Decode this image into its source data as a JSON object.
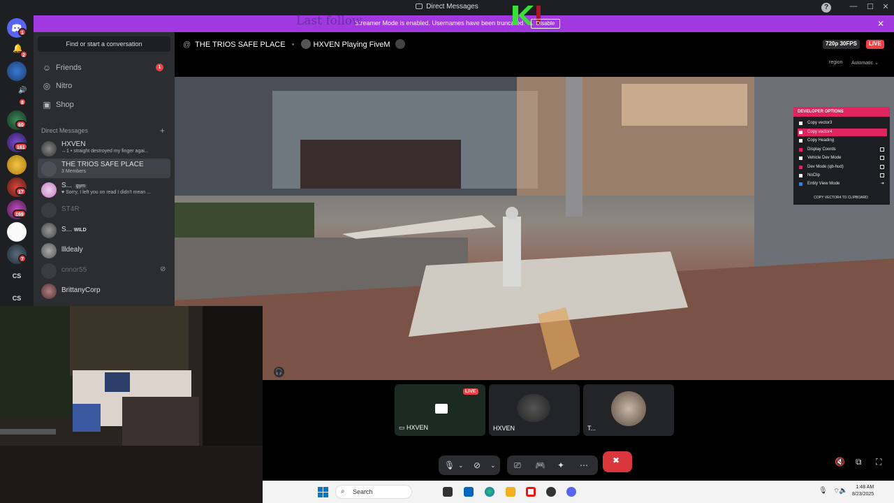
{
  "window": {
    "title": "Direct Messages",
    "help": "?",
    "minimize": "—",
    "maximize": "☐",
    "close": "✕"
  },
  "banner": {
    "message": "Streamer Mode is enabled. Usernames have been truncated.",
    "disable": "Disable",
    "close": "✕"
  },
  "overlay": {
    "last_follow": "Last follow"
  },
  "rail": {
    "badges": {
      "dm": "1",
      "server2": "2",
      "server3": "8",
      "server4": "60",
      "server5": "161",
      "server7": "17",
      "server8": "169",
      "server10": "7"
    },
    "cs1": "CS",
    "cs2": "CS"
  },
  "sidebar": {
    "find": "Find or start a conversation",
    "nav": [
      {
        "label": "Friends",
        "badge": "1"
      },
      {
        "label": "Nitro"
      },
      {
        "label": "Shop"
      }
    ],
    "dm_header": "Direct Messages",
    "dm_add": "+",
    "dms": [
      {
        "name": "HXVEN",
        "sub": "↔1 • straight destroyed my finger agai..."
      },
      {
        "name": "THE TRIOS SAFE PLACE",
        "sub": "3 Members"
      },
      {
        "name": "S...",
        "tag": "gym",
        "sub": "♥ Sorry, I left you on read I didn't mean ..."
      },
      {
        "name": "ST4R"
      },
      {
        "name": "S...",
        "tag": "WILD"
      },
      {
        "name": "llldealy"
      },
      {
        "name": "cnnor55"
      },
      {
        "name": "BrittanyCorp"
      }
    ]
  },
  "call": {
    "channel": "THE TRIOS SAFE PLACE",
    "activity": "HXVEN Playing FiveM",
    "quality": "720p 30FPS",
    "live": "LIVE",
    "region": "region",
    "region_value": "Automatic"
  },
  "dev_options": {
    "title": "DEVELOPER OPTIONS",
    "items": [
      {
        "label": "Copy vector3",
        "selected": false,
        "check": false
      },
      {
        "label": "Copy vector4",
        "selected": true,
        "check": false
      },
      {
        "label": "Copy Heading",
        "selected": false,
        "check": false
      },
      {
        "label": "Display Coords",
        "selected": false,
        "check": true
      },
      {
        "label": "Vehicle Dev Mode",
        "selected": false,
        "check": true
      },
      {
        "label": "Dev Mode (qb-hud)",
        "selected": false,
        "check": true
      },
      {
        "label": "NoClip",
        "selected": false,
        "check": true
      },
      {
        "label": "Entity View Mode",
        "selected": false,
        "check": false
      }
    ],
    "footer": "COPY VECTOR4 TO CLIPBOARD"
  },
  "tiles": [
    {
      "name": "HXVEN",
      "live": "LIVE"
    },
    {
      "name": "HXVEN"
    },
    {
      "name": "T..."
    }
  ],
  "taskbar": {
    "search": "Search",
    "time": "1:48 AM",
    "date": "8/23/2025"
  },
  "colors": {
    "banner": "#a239e0",
    "live": "#f23f42",
    "dev_accent": "#e0245e",
    "hangup": "#da373c"
  }
}
